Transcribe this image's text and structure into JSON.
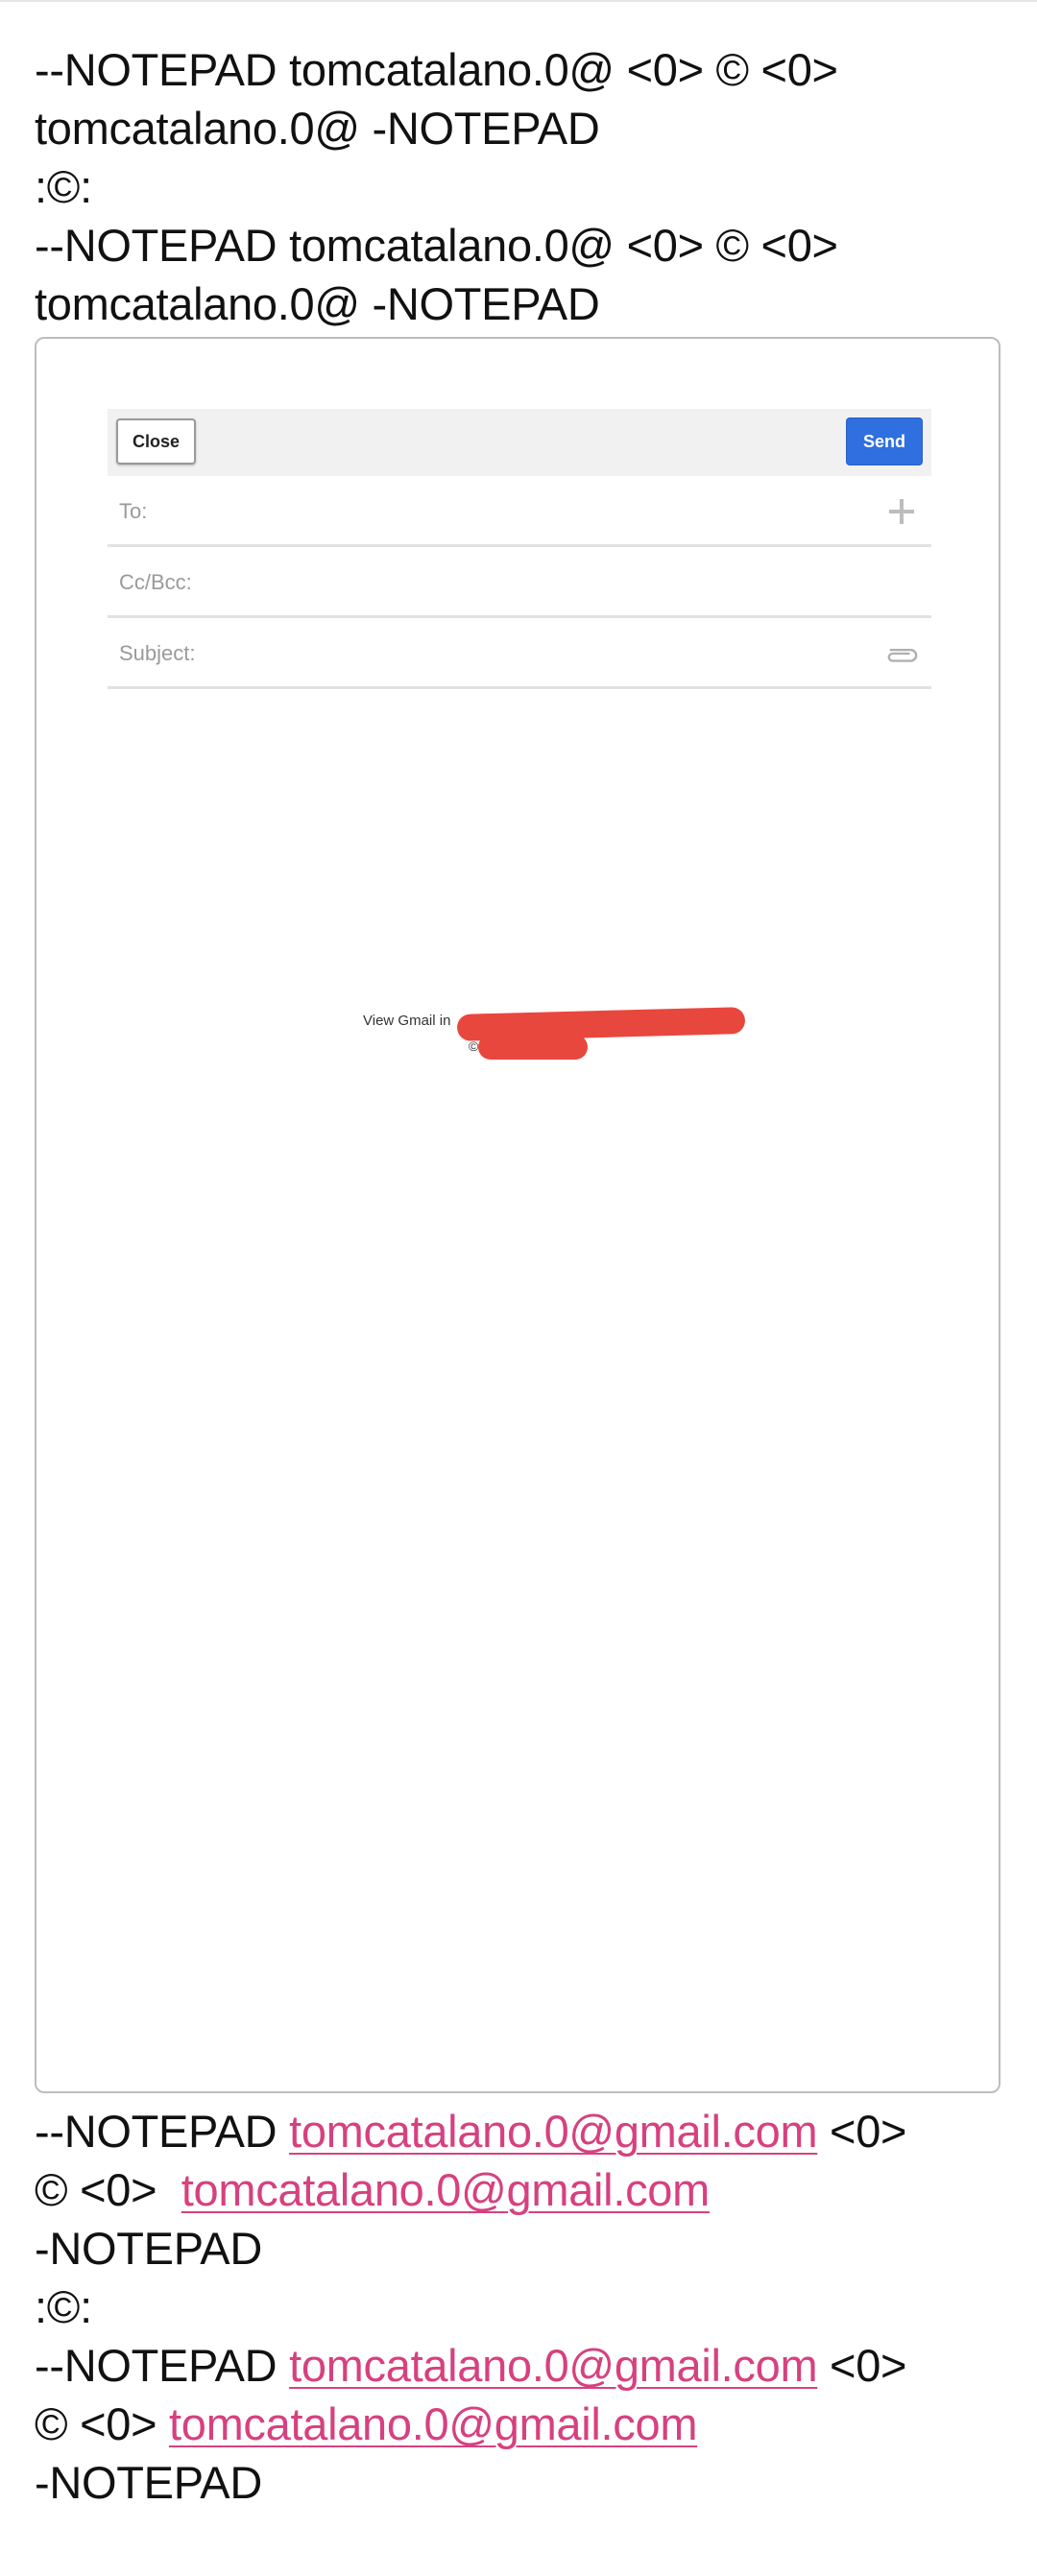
{
  "top_text": {
    "line1": "--NOTEPAD tomcatalano.0@ <0> © <0>",
    "line2": "tomcatalano.0@ -NOTEPAD",
    "line3": ":©:",
    "line4": "--NOTEPAD tomcatalano.0@ <0> © <0>",
    "line5": "tomcatalano.0@ -NOTEPAD"
  },
  "compose": {
    "close_label": "Close",
    "send_label": "Send",
    "to_label": "To:",
    "ccbcc_label": "Cc/Bcc:",
    "subject_label": "Subject:",
    "add_icon": "plus-icon",
    "attach_icon": "paperclip-icon"
  },
  "footer": {
    "view_gmail": "View Gmail in",
    "copyright": "©",
    "redaction_color": "#e8473e"
  },
  "bottom_text": {
    "b1_prefix": "--NOTEPAD ",
    "b1_link": "tomcatalano.0@gmail.com",
    "b1_suffix": " <0>",
    "b2_prefix": "© <0>  ",
    "b2_link": "tomcatalano.0@gmail.com",
    "b3": "-NOTEPAD",
    "b4": ":©:",
    "b5_prefix": "--NOTEPAD ",
    "b5_link": "tomcatalano.0@gmail.com",
    "b5_suffix": " <0>",
    "b6_prefix": "© <0> ",
    "b6_link": "tomcatalano.0@gmail.com",
    "b7": "-NOTEPAD"
  },
  "colors": {
    "link": "#d6417f",
    "send_button": "#2f6fe0",
    "toolbar_bg": "#f1f1f1"
  }
}
